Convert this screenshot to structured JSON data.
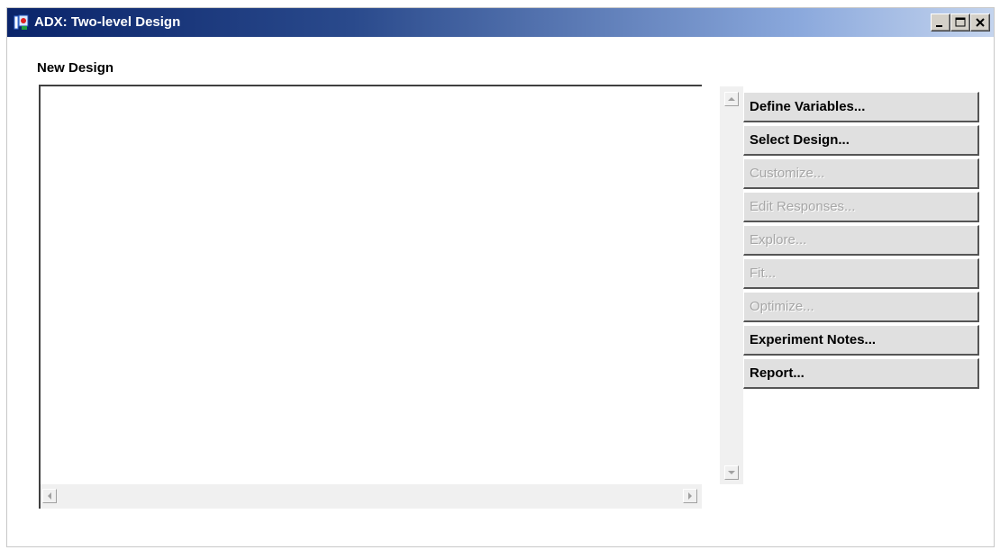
{
  "window": {
    "title": "ADX: Two-level Design",
    "icon": "adx-app-icon",
    "controls": [
      "minimize-icon",
      "maximize-icon",
      "close-icon"
    ]
  },
  "section": {
    "label": "New Design"
  },
  "listbox": {
    "items": []
  },
  "buttons": [
    {
      "label": "Define Variables...",
      "enabled": true
    },
    {
      "label": "Select Design...",
      "enabled": true
    },
    {
      "label": "Customize...",
      "enabled": false
    },
    {
      "label": "Edit Responses...",
      "enabled": false
    },
    {
      "label": "Explore...",
      "enabled": false
    },
    {
      "label": "Fit...",
      "enabled": false
    },
    {
      "label": "Optimize...",
      "enabled": false
    },
    {
      "label": "Experiment Notes...",
      "enabled": true
    },
    {
      "label": "Report...",
      "enabled": true
    }
  ],
  "colors": {
    "titlebar_start": "#0a246a",
    "titlebar_end": "#c4d4ee",
    "button_face": "#e0e0e0",
    "disabled_text": "#a6a6a6"
  }
}
